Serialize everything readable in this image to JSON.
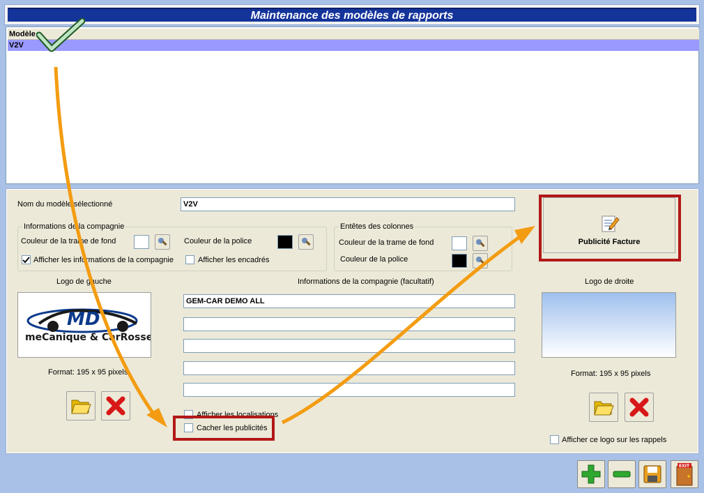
{
  "window": {
    "title": "Maintenance des modèles de rapports"
  },
  "list": {
    "header": "Modèle",
    "rows": [
      "V2V"
    ]
  },
  "form": {
    "model_name_label": "Nom du modèle sélectionné",
    "model_name_value": "V2V",
    "company_group": {
      "title": "Informations de la compagnie",
      "bg_label": "Couleur de la trame de fond",
      "font_label": "Couleur de la police",
      "show_info_label": "Afficher les informations de la compagnie",
      "show_frames_label": "Afficher les encadrés",
      "bg_color": "#ffffff",
      "font_color": "#000000"
    },
    "columns_group": {
      "title": "Entêtes des colonnes",
      "bg_label": "Couleur de la trame de fond",
      "font_label": "Couleur de la police",
      "bg_color": "#ffffff",
      "font_color": "#000000"
    },
    "left_logo": {
      "label": "Logo de gauche",
      "format": "Format: 195 x 95 pixels",
      "logo_top": "MD",
      "logo_bottom": "meCanique & CarRosserie"
    },
    "company_info": {
      "label": "Informations de la compagnie (facultatif)",
      "lines": [
        "GEM-CAR DEMO ALL",
        "",
        "",
        "",
        ""
      ]
    },
    "right_logo": {
      "label": "Logo de droite",
      "format": "Format: 195 x 95 pixels",
      "show_on_reminders_label": "Afficher ce logo sur les rappels"
    },
    "show_locations_label": "Afficher les localisations",
    "hide_ads_label": "Cacher les publicités",
    "pub_button_label": "Publicité Facture"
  },
  "colors": {
    "accent": "#14349a",
    "highlight": "#b21818",
    "arrow": "#f39c12",
    "selection": "#9999ff"
  },
  "icons": {
    "folder": "folder-open-icon",
    "delete": "red-x-icon",
    "add": "plus-icon",
    "remove": "minus-icon",
    "save": "floppy-disk-icon",
    "exit": "exit-door-icon",
    "pub": "edit-document-icon",
    "checkmark": "checkmark-icon"
  },
  "toolbar": {
    "exit_label": "EXIT"
  }
}
